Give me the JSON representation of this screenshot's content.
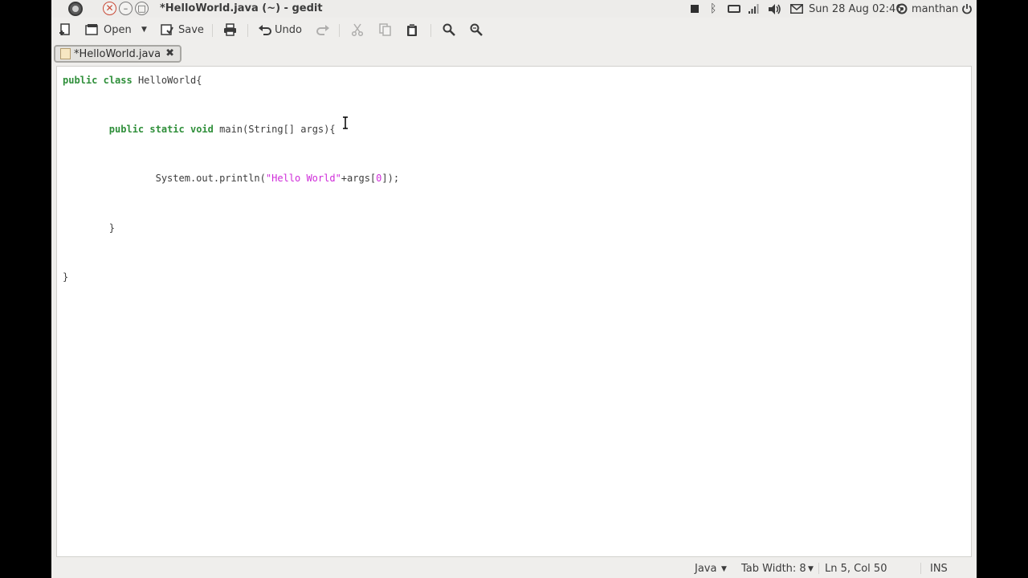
{
  "window": {
    "title": "*HelloWorld.java (~) - gedit",
    "close_icon": "close-icon",
    "minimize_icon": "minimize-icon",
    "maximize_icon": "maximize-icon"
  },
  "panel": {
    "clock": "Sun 28 Aug 02:46",
    "username": "manthan",
    "indicators": [
      "stop-icon",
      "bluetooth-icon",
      "battery-icon",
      "network-signal-icon",
      "volume-icon",
      "mail-icon",
      "user-icon",
      "power-icon"
    ]
  },
  "toolbar": {
    "open_label": "Open",
    "save_label": "Save",
    "undo_label": "Undo"
  },
  "tabs": [
    {
      "label": "*HelloWorld.java",
      "active": true
    }
  ],
  "editor": {
    "language": "Java",
    "lines": [
      "public class HelloWorld{",
      "",
      "        public static void main(String[] args){",
      "",
      "                System.out.println(\"Hello World\"+args[0]);",
      "",
      "        }",
      "",
      "}"
    ]
  },
  "statusbar": {
    "language": "Java",
    "tab_width": "Tab Width: 8",
    "position": "Ln 5, Col 50",
    "mode": "INS"
  },
  "colors": {
    "keyword": "#2f8f3a",
    "string": "#cf2bd9",
    "background": "#efeeec",
    "close_button": "#c84a37"
  }
}
